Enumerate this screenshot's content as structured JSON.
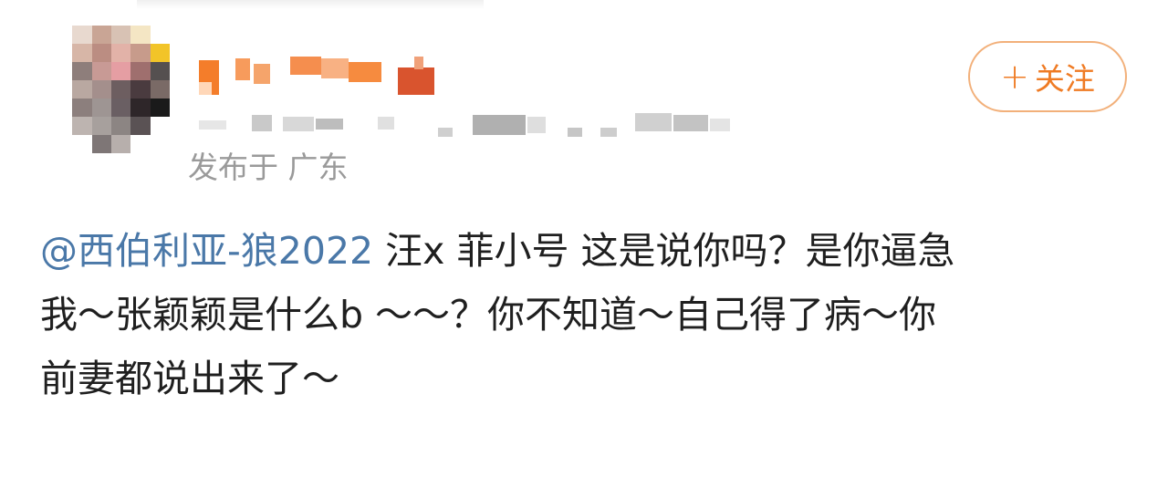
{
  "post": {
    "author": {
      "avatar_icon": "avatar-pixelated",
      "name_icon": "username-blurred",
      "meta_icon": "post-meta-blurred"
    },
    "location_text": "发布于 广东",
    "follow_button": {
      "icon": "plus-icon",
      "plus": "+",
      "label": "关注",
      "color": "#ef7b24"
    },
    "comment": {
      "mention": "@西伯利亚-狼2022",
      "mention_color": "#4a78a8",
      "line1_text": " 汪x 菲小号 这是说你吗？是你逼急",
      "line2_text": "我～张颖颖是什么b ～～？你不知道～自己得了病～你",
      "line3_text": "前妻都说出来了～"
    }
  }
}
